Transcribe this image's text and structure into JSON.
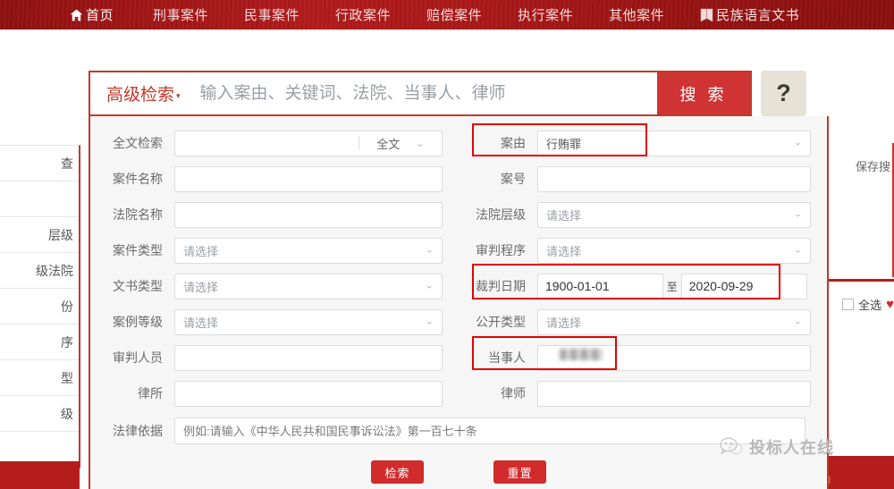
{
  "nav": {
    "items": [
      {
        "label": "首页",
        "icon": "home-icon"
      },
      {
        "label": "刑事案件",
        "icon": ""
      },
      {
        "label": "民事案件",
        "icon": ""
      },
      {
        "label": "行政案件",
        "icon": ""
      },
      {
        "label": "赔偿案件",
        "icon": ""
      },
      {
        "label": "执行案件",
        "icon": ""
      },
      {
        "label": "其他案件",
        "icon": ""
      },
      {
        "label": "民族语言文书",
        "icon": "book-icon"
      }
    ]
  },
  "search": {
    "advanced_label": "高级检索",
    "caret": "▾",
    "placeholder": "输入案由、关键词、法院、当事人、律师",
    "value": "",
    "button_label": "搜 索",
    "help_label": "?"
  },
  "form": {
    "left": [
      {
        "label": "全文检索",
        "type": "fulltext",
        "value": "",
        "placeholder": "",
        "scope": "全文"
      },
      {
        "label": "案件名称",
        "type": "input",
        "value": "",
        "placeholder": ""
      },
      {
        "label": "法院名称",
        "type": "input",
        "value": "",
        "placeholder": ""
      },
      {
        "label": "案件类型",
        "type": "select",
        "value": "请选择"
      },
      {
        "label": "文书类型",
        "type": "select",
        "value": "请选择"
      },
      {
        "label": "案例等级",
        "type": "select",
        "value": "请选择"
      },
      {
        "label": "审判人员",
        "type": "input",
        "value": "",
        "placeholder": ""
      },
      {
        "label": "律所",
        "type": "input",
        "value": "",
        "placeholder": ""
      }
    ],
    "right": [
      {
        "label": "案由",
        "type": "select",
        "value": "行贿罪",
        "highlighted": true
      },
      {
        "label": "案号",
        "type": "input",
        "value": "",
        "placeholder": ""
      },
      {
        "label": "法院层级",
        "type": "select",
        "value": "请选择"
      },
      {
        "label": "审判程序",
        "type": "select",
        "value": "请选择"
      },
      {
        "label": "裁判日期",
        "type": "daterange",
        "from": "1900-01-01",
        "to": "2020-09-29",
        "sep": "至",
        "highlighted": true
      },
      {
        "label": "公开类型",
        "type": "select",
        "value": "请选择"
      },
      {
        "label": "当事人",
        "type": "input",
        "value": "",
        "placeholder": "",
        "redacted": true,
        "highlighted": true
      },
      {
        "label": "律师",
        "type": "input",
        "value": "",
        "placeholder": ""
      }
    ],
    "law": {
      "label": "法律依据",
      "value": "",
      "placeholder": "例如:请输入《中华人民共和国民事诉讼法》第一百七十条"
    },
    "buttons": {
      "submit_label": "检索",
      "reset_label": "重置"
    }
  },
  "background": {
    "left_rows": [
      "查",
      "",
      "层级",
      "级法院",
      "份",
      "序",
      "型",
      "级",
      ""
    ],
    "save_search_label": "保存搜",
    "select_all_label": "全选",
    "heart_icon": "♥"
  },
  "watermark": {
    "text": "投标人在线",
    "icon": "wechat-icon"
  },
  "colors": {
    "nav_red": "#a81717",
    "accent_red": "#c0392b",
    "button_red": "#d12b2b",
    "search_btn_red": "#cf3333",
    "highlight_red": "#e60000",
    "panel_bg": "#f6f6f6",
    "help_bg": "#e7e2d6"
  }
}
